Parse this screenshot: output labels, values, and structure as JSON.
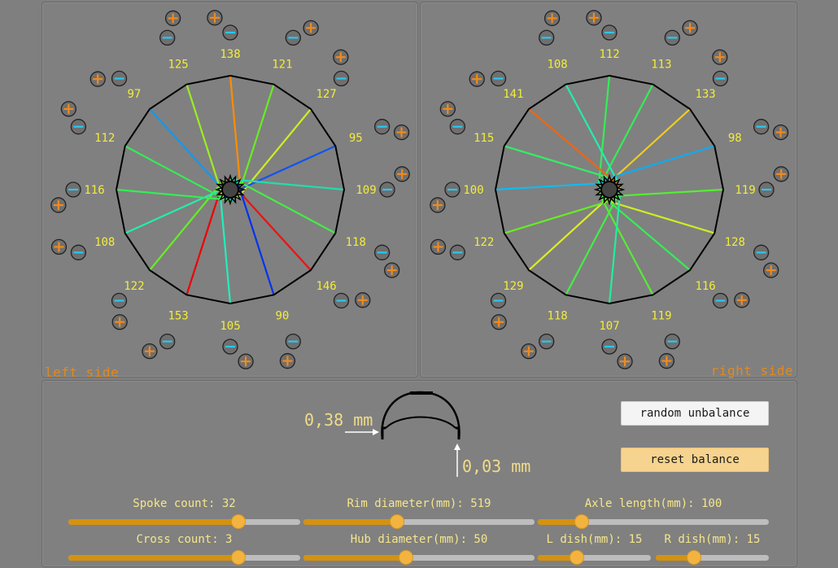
{
  "colors": {
    "rim": "#000000",
    "label": "#f2ec3a",
    "minus": "#29c8f0",
    "plus": "#f08a1e",
    "button_ring": "#222222"
  },
  "icons": {
    "increase": "plus-icon",
    "decrease": "minus-icon"
  },
  "left_wheel": {
    "side_label": "left side",
    "spokes": [
      {
        "tension": "138",
        "color": "#ff8c00"
      },
      {
        "tension": "121",
        "color": "#66ee22"
      },
      {
        "tension": "127",
        "color": "#ccee22"
      },
      {
        "tension": "95",
        "color": "#1155ee"
      },
      {
        "tension": "109",
        "color": "#22ddaa"
      },
      {
        "tension": "118",
        "color": "#44ee44"
      },
      {
        "tension": "146",
        "color": "#ee1111"
      },
      {
        "tension": "90",
        "color": "#0033ee"
      },
      {
        "tension": "105",
        "color": "#22eebb"
      },
      {
        "tension": "153",
        "color": "#ee0000"
      },
      {
        "tension": "122",
        "color": "#66ee22"
      },
      {
        "tension": "108",
        "color": "#22eeaa"
      },
      {
        "tension": "116",
        "color": "#33ee55"
      },
      {
        "tension": "112",
        "color": "#33ee55"
      },
      {
        "tension": "97",
        "color": "#1199ee"
      },
      {
        "tension": "125",
        "color": "#99ee22"
      }
    ]
  },
  "right_wheel": {
    "side_label": "right side",
    "spokes": [
      {
        "tension": "112",
        "color": "#33ee55"
      },
      {
        "tension": "113",
        "color": "#33ee55"
      },
      {
        "tension": "133",
        "color": "#eecc22"
      },
      {
        "tension": "98",
        "color": "#11aaee"
      },
      {
        "tension": "119",
        "color": "#55ee33"
      },
      {
        "tension": "128",
        "color": "#ccee22"
      },
      {
        "tension": "116",
        "color": "#33ee55"
      },
      {
        "tension": "119",
        "color": "#55ee33"
      },
      {
        "tension": "107",
        "color": "#22ee99"
      },
      {
        "tension": "118",
        "color": "#44ee44"
      },
      {
        "tension": "129",
        "color": "#ddee22"
      },
      {
        "tension": "122",
        "color": "#66ee22"
      },
      {
        "tension": "100",
        "color": "#11bbee"
      },
      {
        "tension": "115",
        "color": "#33ee66"
      },
      {
        "tension": "141",
        "color": "#ee6611"
      },
      {
        "tension": "108",
        "color": "#22eeaa"
      }
    ]
  },
  "measurements": {
    "lateral": "0,38 mm",
    "radial": "0,03 mm"
  },
  "buttons": {
    "random": "random unbalance",
    "reset": "reset balance"
  },
  "sliders": [
    {
      "label": "Spoke count: 32",
      "fraction": 0.735
    },
    {
      "label": "Rim diameter(mm): 519",
      "fraction": 0.405
    },
    {
      "label": "Axle length(mm): 100",
      "fraction": 0.19
    },
    {
      "label": "Cross count: 3",
      "fraction": 0.735
    },
    {
      "label": "Hub diameter(mm): 50",
      "fraction": 0.445
    },
    {
      "label": "L dish(mm): 15",
      "fraction": 0.345
    },
    {
      "label": "R dish(mm): 15",
      "fraction": 0.335
    }
  ]
}
